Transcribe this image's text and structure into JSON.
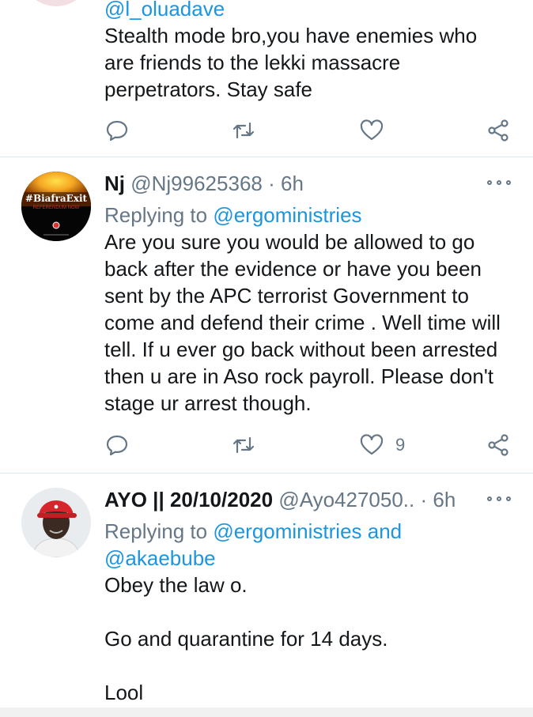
{
  "tweet_top": {
    "handle_link": "@l_oluadave",
    "text": "Stealth mode bro,you have enemies who are friends to the lekki massacre perpetrators. Stay safe"
  },
  "tweet_nj": {
    "display_name": "Nj",
    "handle": "@Nj99625368",
    "separator": "·",
    "time": "6h",
    "replying_prefix": "Replying to",
    "replying_to": "@ergoministries",
    "text": "Are you sure you would be allowed to go back after the evidence or have you been sent by the APC terrorist Government to come and defend their crime . Well time will tell. If u ever go back without been arrested then u are in Aso rock payroll. Please don't stage ur arrest though.",
    "like_count": "9",
    "avatar_text": "#BiafraExit",
    "avatar_subtext": "REFERENDUM NOW"
  },
  "tweet_ayo": {
    "display_name": "AYO || 20/10/2020",
    "handle": "@Ayo427050..",
    "separator": "·",
    "time": "6h",
    "replying_prefix": "Replying to",
    "replying_to": "@ergoministries and",
    "replying_to_2": "@akaebube",
    "text_line_1": "Obey the law o.",
    "text_line_2": "Go and quarantine for 14 days.",
    "text_line_3": "Lool"
  },
  "icons": [
    "reply-icon",
    "retweet-icon",
    "like-icon",
    "share-icon",
    "more-icon"
  ],
  "colors": {
    "link": "#1b95e0",
    "muted": "#657786",
    "text": "#14171a",
    "divider": "#e1e8ed"
  }
}
